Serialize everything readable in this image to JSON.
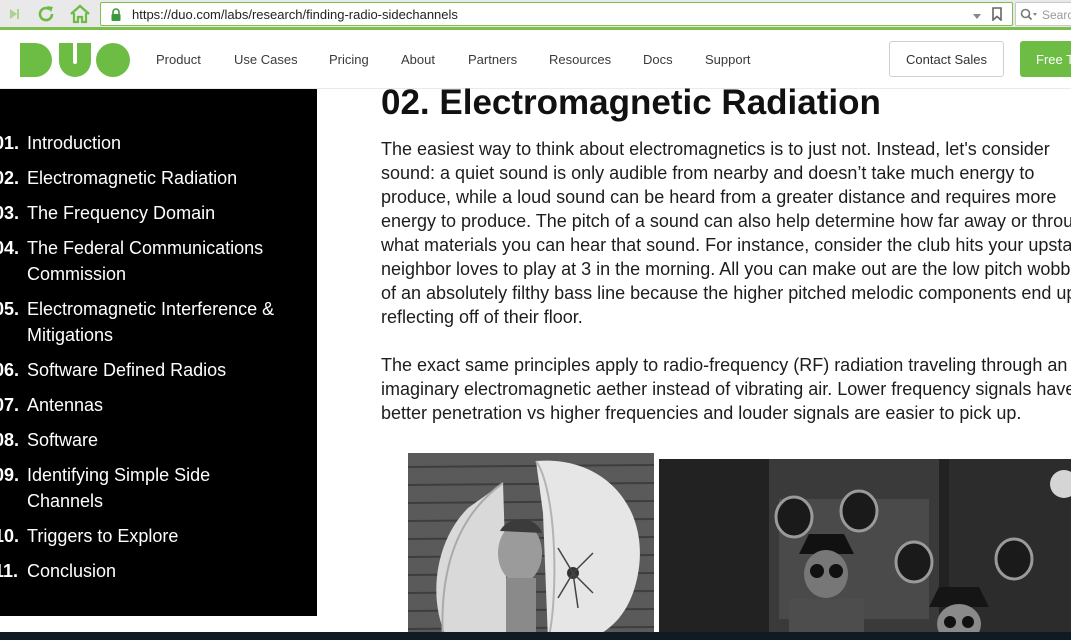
{
  "browser": {
    "url": "https://duo.com/labs/research/finding-radio-sidechannels",
    "search_placeholder": "Search",
    "accent_color": "#7cc04b"
  },
  "nav": {
    "links": [
      "Product",
      "Use Cases",
      "Pricing",
      "About",
      "Partners",
      "Resources",
      "Docs",
      "Support"
    ],
    "contact_label": "Contact Sales",
    "free_label": "Free Trial",
    "brand_color": "#6dbd45"
  },
  "toc": {
    "items": [
      {
        "num": "01.",
        "lines": [
          "Introduction"
        ]
      },
      {
        "num": "02.",
        "lines": [
          "Electromagnetic Radiation"
        ]
      },
      {
        "num": "03.",
        "lines": [
          "The Frequency Domain"
        ]
      },
      {
        "num": "04.",
        "lines": [
          "The Federal Communications",
          "Commission"
        ]
      },
      {
        "num": "05.",
        "lines": [
          "Electromagnetic Interference &",
          "Mitigations"
        ]
      },
      {
        "num": "06.",
        "lines": [
          "Software Defined Radios"
        ]
      },
      {
        "num": "07.",
        "lines": [
          "Antennas"
        ]
      },
      {
        "num": "08.",
        "lines": [
          "Software"
        ]
      },
      {
        "num": "09.",
        "lines": [
          "Identifying Simple Side",
          "Channels"
        ]
      },
      {
        "num": "10.",
        "lines": [
          "Triggers to Explore"
        ]
      },
      {
        "num": "11.",
        "lines": [
          "Conclusion"
        ]
      }
    ]
  },
  "article": {
    "heading": "02. Electromagnetic Radiation",
    "paragraph1_lines": [
      "The easiest way to think about electromagnetics is to just not. Instead, let's consider",
      "sound: a quiet sound is only audible from nearby and doesn’t take much energy to",
      "produce, while a loud sound can be heard from a greater distance and requires more",
      "energy to produce. The pitch of a sound can also help determine how far away or through",
      "what materials you can hear that sound. For instance, consider the club hits your upstairs",
      "neighbor loves to play at 3 in the morning. All you can make out are the low pitch wobbles",
      "of an absolutely filthy bass line because the higher pitched melodic components end up",
      "reflecting off of their floor."
    ],
    "paragraph2_lines": [
      "The exact same principles apply to radio-frequency (RF) radiation traveling through an",
      "imaginary electromagnetic aether instead of vibrating air. Lower frequency signals have",
      "better penetration vs higher frequencies and louder signals are easier to pick up."
    ]
  }
}
